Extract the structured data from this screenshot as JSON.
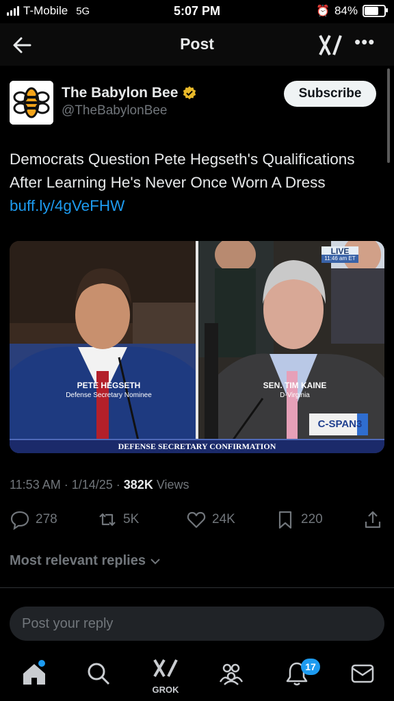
{
  "status_bar": {
    "carrier": "T-Mobile",
    "network": "5G",
    "time": "5:07 PM",
    "battery": "84%",
    "battery_level": 0.84
  },
  "nav": {
    "title": "Post",
    "logo": "𝕏I",
    "more": "•••"
  },
  "author": {
    "name": "The Babylon Bee",
    "handle": "@TheBabylonBee",
    "subscribe_label": "Subscribe",
    "verified_color": "#e8b829"
  },
  "post": {
    "text": "Democrats Question Pete Hegseth's Qualifications After Learning He's Never Once Worn A Dress ",
    "link": "buff.ly/4gVeFHW"
  },
  "media": {
    "live_label": "LIVE",
    "live_time": "11:46 am ET",
    "left_name": "PETE HEGSETH",
    "left_title": "Defense Secretary Nominee",
    "right_name": "SEN. TIM KAINE",
    "right_title": "D-Virginia",
    "network_logo": "C-SPAN3",
    "banner": "DEFENSE SECRETARY CONFIRMATION"
  },
  "meta": {
    "time": "11:53 AM",
    "date": "1/14/25",
    "views_count": "382K",
    "views_label": "Views"
  },
  "actions": {
    "replies": "278",
    "reposts": "5K",
    "likes": "24K",
    "bookmarks": "220"
  },
  "replies_sort": "Most relevant replies",
  "reply_placeholder": "Post your reply",
  "tabbar": {
    "grok_label": "GROK",
    "notifications_badge": "17"
  },
  "colors": {
    "accent": "#1d9bf0",
    "background": "#000000",
    "muted": "#71767b"
  }
}
